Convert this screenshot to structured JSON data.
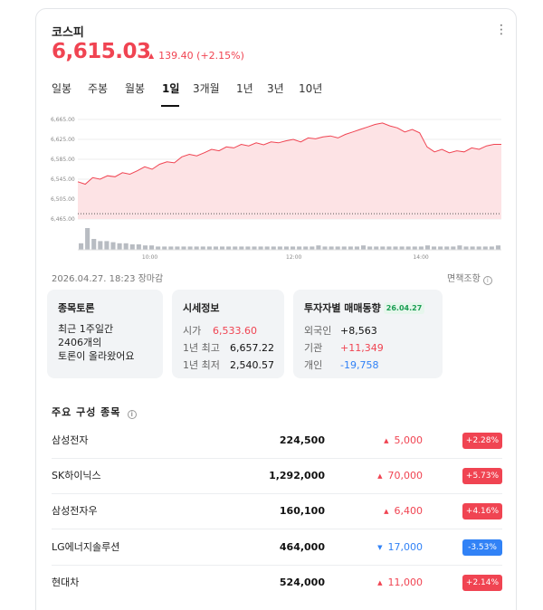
{
  "index": {
    "name": "코스피",
    "price": "6,615.03",
    "change_abs": "139.40",
    "change_pct": "(+2.15%)",
    "up_color": "#f04452",
    "down_color": "#3182f6"
  },
  "tabs": [
    {
      "label": "일봉",
      "active": false
    },
    {
      "label": "주봉",
      "active": false
    },
    {
      "label": "월봉",
      "active": false
    },
    {
      "label": "1일",
      "active": true
    },
    {
      "label": "3개월",
      "active": false
    },
    {
      "label": "1년",
      "active": false
    },
    {
      "label": "3년",
      "active": false
    },
    {
      "label": "10년",
      "active": false
    }
  ],
  "chart_data": {
    "type": "area",
    "y_ticks": [
      "6,665.00",
      "6,625.00",
      "6,585.00",
      "6,545.00",
      "6,505.00",
      "6,465.00"
    ],
    "ylim": [
      6465,
      6665
    ],
    "x_ticks": [
      "10:00",
      "12:00",
      "14:00"
    ],
    "prev_close_line": 6475.63,
    "series": [
      {
        "values": [
          6540,
          6535,
          6548,
          6545,
          6552,
          6550,
          6558,
          6555,
          6562,
          6570,
          6565,
          6575,
          6580,
          6578,
          6590,
          6595,
          6592,
          6598,
          6605,
          6602,
          6610,
          6608,
          6615,
          6612,
          6618,
          6614,
          6620,
          6618,
          6622,
          6625,
          6620,
          6628,
          6626,
          6630,
          6632,
          6628,
          6635,
          6640,
          6645,
          6650,
          6655,
          6658,
          6652,
          6648,
          6640,
          6645,
          6638,
          6610,
          6600,
          6605,
          6598,
          6602,
          6600,
          6608,
          6605,
          6612,
          6615,
          6615
        ]
      }
    ],
    "volume": [
      3,
      10,
      5,
      4,
      4,
      3.5,
      3,
      3,
      2.5,
      2.5,
      2,
      2,
      1.5,
      1.5,
      1.5,
      1.5,
      1.5,
      1.5,
      1.5,
      1.5,
      1.5,
      1.5,
      1.5,
      1.5,
      1.5,
      1.5,
      1.5,
      1.5,
      1.5,
      1.5,
      1.5,
      1.5,
      1.5,
      1.5,
      1.5,
      1.5,
      1.5,
      2,
      1.5,
      1.5,
      1.5,
      1.5,
      1.5,
      1.5,
      2,
      1.5,
      1.5,
      1.5,
      1.5,
      1.5,
      1.5,
      1.5,
      1.5,
      1.5,
      2,
      1.5,
      1.5,
      1.5,
      1.5,
      2,
      1.5,
      1.5,
      1.5,
      1.5,
      1.5,
      2
    ]
  },
  "meta": {
    "timestamp": "2026.04.27. 18:23 장마감",
    "disclaimer": "면책조항",
    "info_glyph": "i"
  },
  "discussion": {
    "title": "종목토론",
    "line1": "최근 1주일간",
    "line2": "2406개의",
    "line3": "토론이 올라왔어요"
  },
  "quote": {
    "title": "시세정보",
    "rows": [
      {
        "label": "시가",
        "value": "6,533.60"
      },
      {
        "label": "1년 최고",
        "value": "6,657.22"
      },
      {
        "label": "1년 최저",
        "value": "2,540.57"
      }
    ]
  },
  "investors": {
    "title": "투자자별 매매동향",
    "date": "26.04.27",
    "rows": [
      {
        "label": "외국인",
        "value": "+8,563"
      },
      {
        "label": "기관",
        "value": "+11,349"
      },
      {
        "label": "개인",
        "value": "-19,758"
      }
    ]
  },
  "components": {
    "title": "주요 구성 종목",
    "up_arrow": "▲",
    "down_arrow": "▼",
    "rows": [
      {
        "name": "삼성전자",
        "price": "224,500",
        "change": "5,000",
        "pct": "+2.28%",
        "dir": "up"
      },
      {
        "name": "SK하이닉스",
        "price": "1,292,000",
        "change": "70,000",
        "pct": "+5.73%",
        "dir": "up"
      },
      {
        "name": "삼성전자우",
        "price": "160,100",
        "change": "6,400",
        "pct": "+4.16%",
        "dir": "up"
      },
      {
        "name": "LG에너지솔루션",
        "price": "464,000",
        "change": "17,000",
        "pct": "-3.53%",
        "dir": "down"
      },
      {
        "name": "현대차",
        "price": "524,000",
        "change": "11,000",
        "pct": "+2.14%",
        "dir": "up"
      }
    ]
  }
}
